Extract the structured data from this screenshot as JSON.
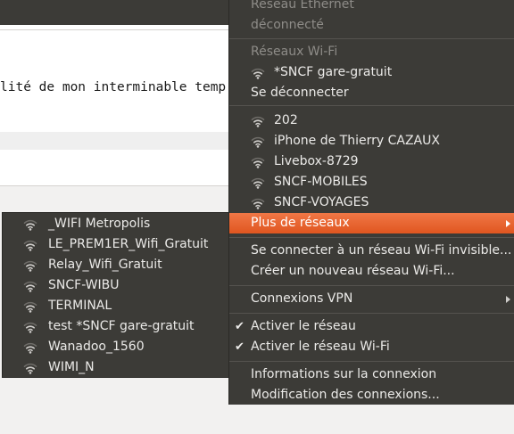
{
  "editor": {
    "visible_line": "lité de mon interminable temp"
  },
  "network_menu": {
    "ethernet_heading": "Réseau Ethernet",
    "ethernet_status": "déconnecté",
    "wifi_heading": "Réseaux Wi-Fi",
    "connected_network": "*SNCF gare-gratuit",
    "disconnect_label": "Se déconnecter",
    "available_networks": [
      "202",
      "iPhone de Thierry CAZAUX",
      "Livebox-8729",
      "SNCF-MOBILES",
      "SNCF-VOYAGES"
    ],
    "more_networks_label": "Plus de réseaux",
    "connect_hidden_label": "Se connecter à un réseau Wi-Fi invisible...",
    "create_network_label": "Créer un nouveau réseau Wi-Fi...",
    "vpn_label": "Connexions VPN",
    "enable_networking_label": "Activer le réseau",
    "enable_wifi_label": "Activer le réseau Wi-Fi",
    "connection_info_label": "Informations sur la connexion",
    "edit_connections_label": "Modification des connexions..."
  },
  "more_networks_submenu": {
    "networks": [
      "_WIFI Metropolis",
      "LE_PREM1ER_Wifi_Gratuit",
      "Relay_Wifi_Gratuit",
      "SNCF-WIBU",
      "TERMINAL",
      "test *SNCF gare-gratuit",
      "Wanadoo_1560",
      "WIMI_N"
    ]
  },
  "colors": {
    "menu_background": "#3c3b37",
    "highlight": "#e35a22",
    "menu_text": "#ebeae8",
    "disabled_text": "#8e8c88"
  },
  "icons": {
    "wifi": "wifi-signal-icon",
    "submenu_arrow": "chevron-right-icon",
    "checked": "check-icon"
  }
}
